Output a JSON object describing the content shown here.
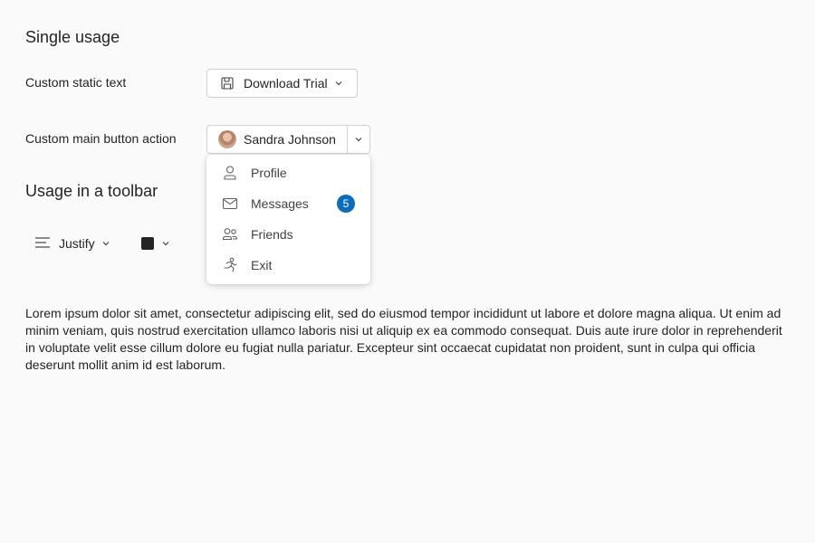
{
  "sections": {
    "single_usage_title": "Single usage",
    "toolbar_usage_title": "Usage in a toolbar"
  },
  "rows": {
    "static_text_label": "Custom static text",
    "main_action_label": "Custom main button action"
  },
  "download_button": {
    "label": "Download Trial",
    "icon": "save-icon"
  },
  "user_button": {
    "name": "Sandra Johnson",
    "avatar": "avatar"
  },
  "menu": {
    "items": [
      {
        "label": "Profile",
        "icon": "person-icon"
      },
      {
        "label": "Messages",
        "icon": "mail-icon",
        "badge": "5"
      },
      {
        "label": "Friends",
        "icon": "people-icon"
      },
      {
        "label": "Exit",
        "icon": "run-icon"
      }
    ]
  },
  "toolbar": {
    "align_label": "Justify",
    "align_icon": "text-align-justify-icon",
    "color_swatch": "#242424"
  },
  "paragraph": "Lorem ipsum dolor sit amet, consectetur adipiscing elit, sed do eiusmod tempor incididunt ut labore et dolore magna aliqua. Ut enim ad minim veniam, quis nostrud exercitation ullamco laboris nisi ut aliquip ex ea commodo consequat. Duis aute irure dolor in reprehenderit in voluptate velit esse cillum dolore eu fugiat nulla pariatur. Excepteur sint occaecat cupidatat non proident, sunt in culpa qui officia deserunt mollit anim id est laborum.",
  "colors": {
    "background": "#fafafa",
    "brand_badge": "#0f6cbd",
    "text": "#242424"
  }
}
